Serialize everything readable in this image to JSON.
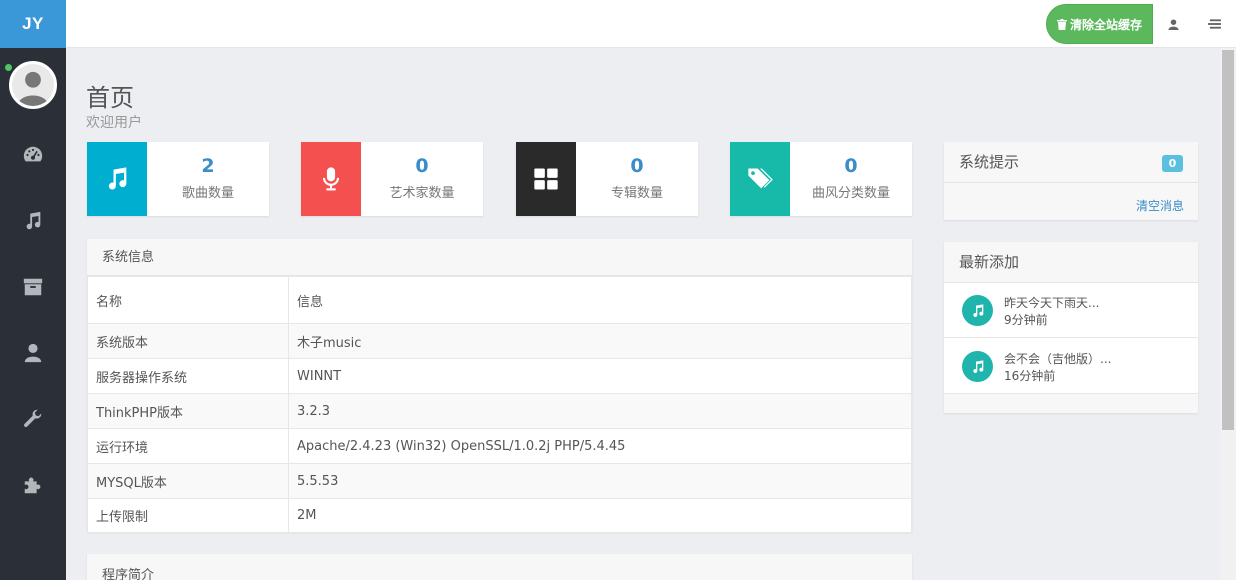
{
  "brand": "JY",
  "colors": {
    "accent": "#3a97d8",
    "sidebar": "#2b2f37",
    "success": "#5cb85c",
    "teal": "#1fb5ac"
  },
  "sidebar": {
    "items": [
      {
        "icon": "dashboard-icon"
      },
      {
        "icon": "music-icon"
      },
      {
        "icon": "archive-icon"
      },
      {
        "icon": "user-icon"
      },
      {
        "icon": "wrench-icon"
      },
      {
        "icon": "puzzle-icon"
      }
    ]
  },
  "topbar": {
    "clear_cache_label": "清除全站缓存",
    "icons": [
      "user-icon",
      "menu-icon"
    ]
  },
  "page": {
    "title": "首页",
    "subtitle": "欢迎用户"
  },
  "stats": [
    {
      "value": "2",
      "label": "歌曲数量",
      "icon": "music-icon",
      "color": "#00aecf"
    },
    {
      "value": "0",
      "label": "艺术家数量",
      "icon": "microphone-icon",
      "color": "#f3504f"
    },
    {
      "value": "0",
      "label": "专辑数量",
      "icon": "grid-icon",
      "color": "#2a2a2a"
    },
    {
      "value": "0",
      "label": "曲风分类数量",
      "icon": "tags-icon",
      "color": "#17b9a8"
    }
  ],
  "system_info": {
    "title": "系统信息",
    "headers": [
      "名称",
      "信息"
    ],
    "rows": [
      [
        "系统版本",
        "木子music"
      ],
      [
        "服务器操作系统",
        "WINNT"
      ],
      [
        "ThinkPHP版本",
        "3.2.3"
      ],
      [
        "运行环境",
        "Apache/2.4.23 (Win32) OpenSSL/1.0.2j PHP/5.4.45"
      ],
      [
        "MYSQL版本",
        "5.5.53"
      ],
      [
        "上传限制",
        "2M"
      ]
    ]
  },
  "intro": {
    "title": "程序简介"
  },
  "notices": {
    "title": "系统提示",
    "count": "0",
    "clear_label": "清空消息"
  },
  "latest": {
    "title": "最新添加",
    "items": [
      {
        "title": "昨天今天下雨天...",
        "time": "9分钟前"
      },
      {
        "title": "会不会（吉他版）...",
        "time": "16分钟前"
      }
    ]
  }
}
